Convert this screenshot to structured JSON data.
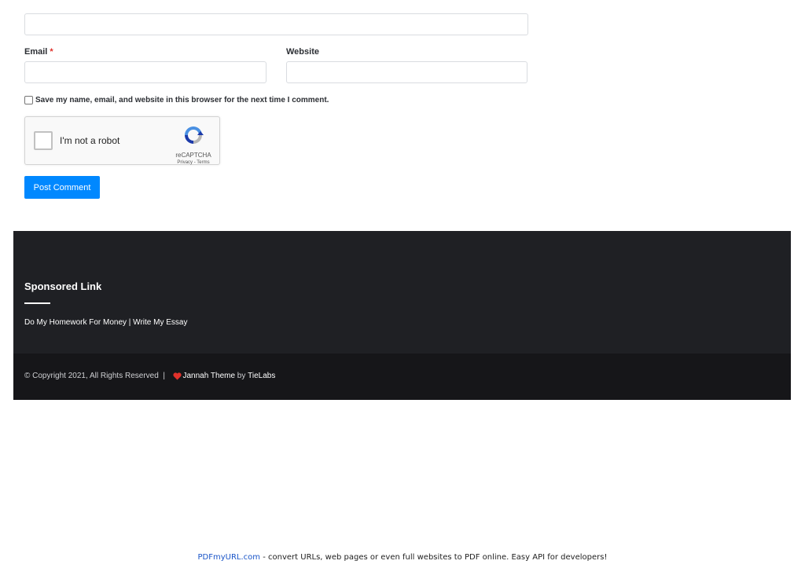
{
  "form": {
    "email_label": "Email",
    "required_mark": "*",
    "website_label": "Website",
    "save_consent_label": "Save my name, email, and website in this browser for the next time I comment.",
    "submit_label": "Post Comment"
  },
  "recaptcha": {
    "prompt": "I'm not a robot",
    "brand": "reCAPTCHA",
    "links": "Privacy - Terms"
  },
  "footer": {
    "widget_title": "Sponsored Link",
    "sponsored_link": "Do My Homework For Money | Write My Essay"
  },
  "copyright": {
    "text": "© Copyright 2021, All Rights Reserved  |  ",
    "theme_link": "Jannah Theme",
    "by_text": " by ",
    "author_link": "TieLabs"
  },
  "pdf_banner": {
    "link": "PDFmyURL.com",
    "text": " - convert URLs, web pages or even full websites to PDF online. Easy API for developers!"
  },
  "colors": {
    "button": "#0088ff",
    "footer_bg": "#1f2024",
    "copyright_bg": "#161619",
    "heart": "#e0312b"
  }
}
